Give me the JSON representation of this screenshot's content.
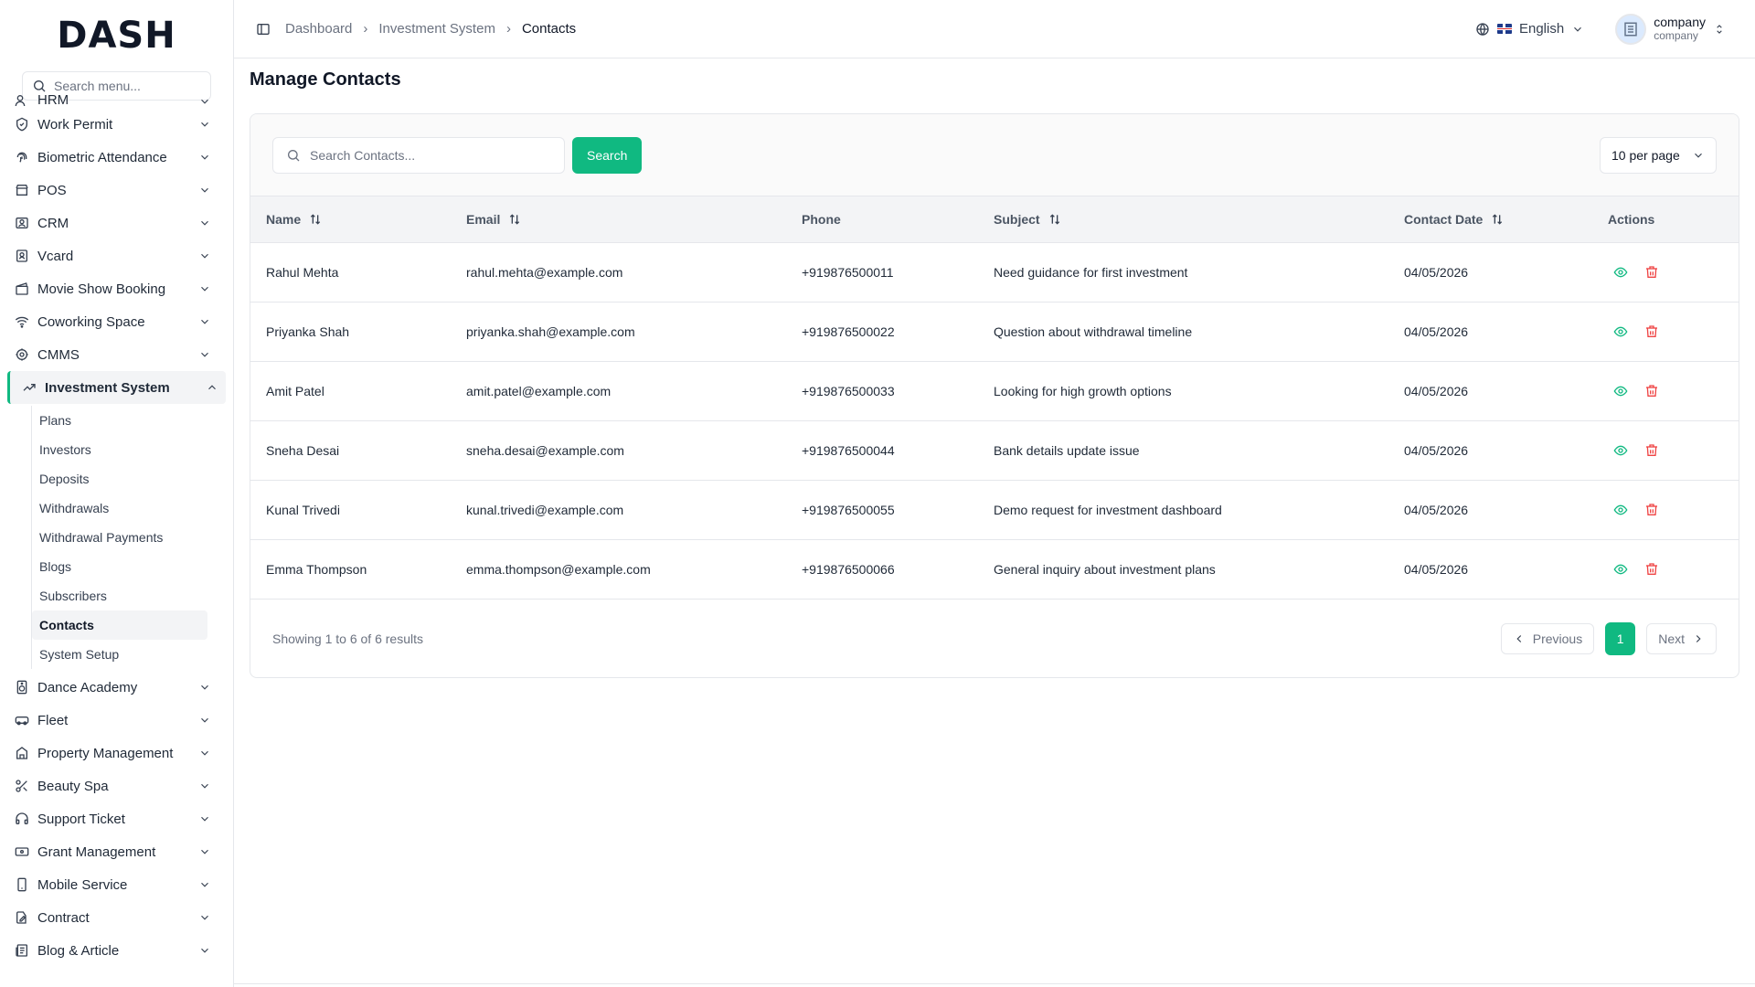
{
  "app": {
    "logo": "DASH",
    "menu_search_placeholder": "Search menu..."
  },
  "sidebar": {
    "items": [
      {
        "label": "HRM",
        "icon": "users-icon"
      },
      {
        "label": "Work Permit",
        "icon": "shield-check-icon"
      },
      {
        "label": "Biometric Attendance",
        "icon": "fingerprint-icon"
      },
      {
        "label": "POS",
        "icon": "store-icon"
      },
      {
        "label": "CRM",
        "icon": "id-card-icon"
      },
      {
        "label": "Vcard",
        "icon": "contact-card-icon"
      },
      {
        "label": "Movie Show Booking",
        "icon": "clapperboard-icon"
      },
      {
        "label": "Coworking Space",
        "icon": "wifi-icon"
      },
      {
        "label": "CMMS",
        "icon": "cog-icon"
      },
      {
        "label": "Investment System",
        "icon": "trending-up-icon"
      },
      {
        "label": "Dance Academy",
        "icon": "speaker-icon"
      },
      {
        "label": "Fleet",
        "icon": "car-icon"
      },
      {
        "label": "Property Management",
        "icon": "building-icon"
      },
      {
        "label": "Beauty Spa",
        "icon": "scissors-icon"
      },
      {
        "label": "Support Ticket",
        "icon": "headphones-icon"
      },
      {
        "label": "Grant Management",
        "icon": "banknote-icon"
      },
      {
        "label": "Mobile Service",
        "icon": "smartphone-icon"
      },
      {
        "label": "Contract",
        "icon": "file-signature-icon"
      },
      {
        "label": "Blog & Article",
        "icon": "newspaper-icon"
      }
    ],
    "sub_items": [
      {
        "label": "Plans"
      },
      {
        "label": "Investors"
      },
      {
        "label": "Deposits"
      },
      {
        "label": "Withdrawals"
      },
      {
        "label": "Withdrawal Payments"
      },
      {
        "label": "Blogs"
      },
      {
        "label": "Subscribers"
      },
      {
        "label": "Contacts"
      },
      {
        "label": "System Setup"
      }
    ]
  },
  "header": {
    "breadcrumb": [
      "Dashboard",
      "Investment System",
      "Contacts"
    ],
    "language": "English",
    "user_name": "company",
    "user_role": "company"
  },
  "page": {
    "title": "Manage Contacts",
    "search_placeholder": "Search Contacts...",
    "search_button": "Search",
    "per_page": "10 per page"
  },
  "table": {
    "columns": [
      "Name",
      "Email",
      "Phone",
      "Subject",
      "Contact Date",
      "Actions"
    ],
    "rows": [
      {
        "name": "Rahul Mehta",
        "email": "rahul.mehta@example.com",
        "phone": "+919876500011",
        "subject": "Need guidance for first investment",
        "date": "04/05/2026"
      },
      {
        "name": "Priyanka Shah",
        "email": "priyanka.shah@example.com",
        "phone": "+919876500022",
        "subject": "Question about withdrawal timeline",
        "date": "04/05/2026"
      },
      {
        "name": "Amit Patel",
        "email": "amit.patel@example.com",
        "phone": "+919876500033",
        "subject": "Looking for high growth options",
        "date": "04/05/2026"
      },
      {
        "name": "Sneha Desai",
        "email": "sneha.desai@example.com",
        "phone": "+919876500044",
        "subject": "Bank details update issue",
        "date": "04/05/2026"
      },
      {
        "name": "Kunal Trivedi",
        "email": "kunal.trivedi@example.com",
        "phone": "+919876500055",
        "subject": "Demo request for investment dashboard",
        "date": "04/05/2026"
      },
      {
        "name": "Emma Thompson",
        "email": "emma.thompson@example.com",
        "phone": "+919876500066",
        "subject": "General inquiry about investment plans",
        "date": "04/05/2026"
      }
    ]
  },
  "pagination": {
    "summary": "Showing 1 to 6 of 6 results",
    "previous": "Previous",
    "current": "1",
    "next": "Next"
  },
  "colors": {
    "accent": "#10b981",
    "view_icon": "#10b981",
    "delete_icon": "#ef4444"
  }
}
